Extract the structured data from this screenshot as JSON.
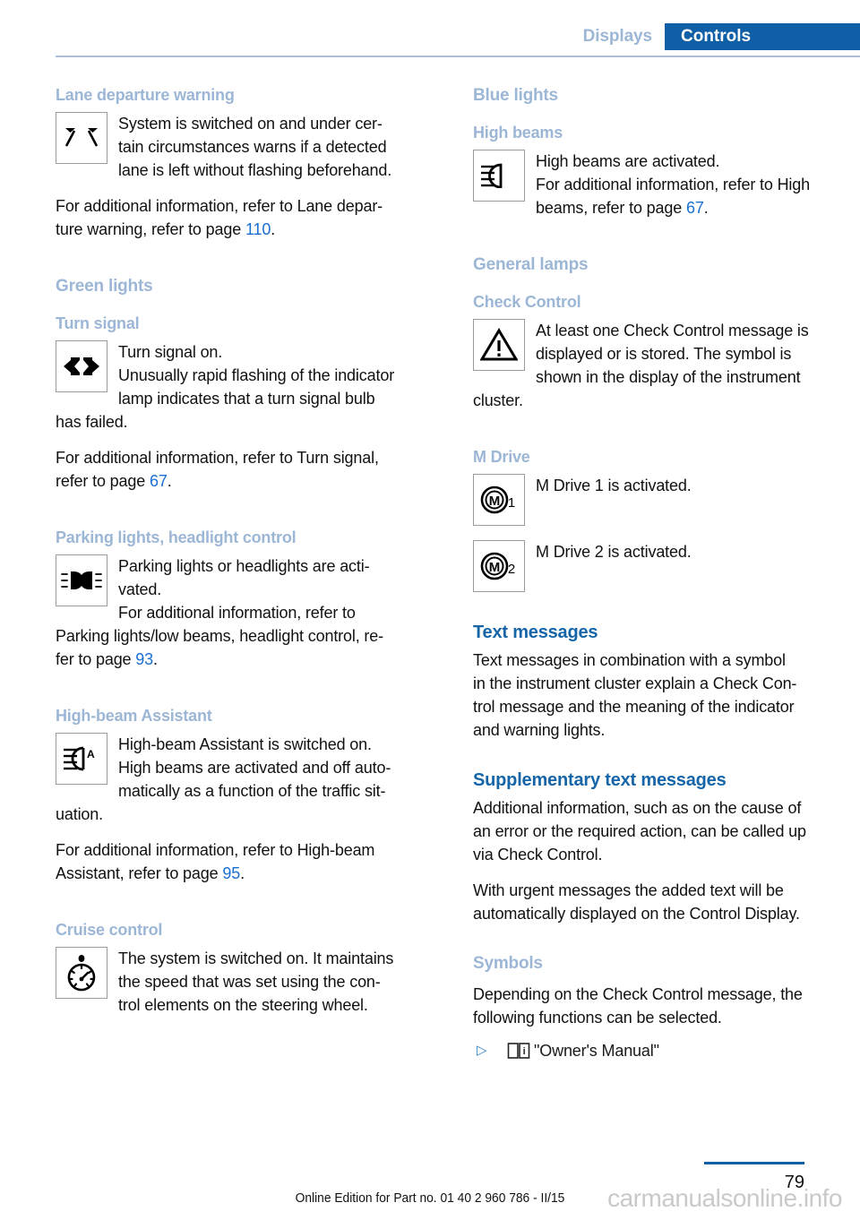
{
  "header": {
    "tab_inactive": "Displays",
    "tab_active": "Controls",
    "accent_blue": "#0f5fa6",
    "light_blue": "#9cb6d6"
  },
  "left_column": {
    "lane_departure": {
      "heading": "Lane departure warning",
      "icon_name": "lane-departure-warning-icon",
      "text_line1": "System is switched on and under cer-",
      "text_line2": "tain circumstances warns if a detected",
      "text_line3": "lane is left without flashing beforehand.",
      "para2_a": "For additional information, refer to Lane depar-",
      "para2_b": "ture warning, refer to page ",
      "page_ref": "110",
      "para2_end": "."
    },
    "green_lights": {
      "heading": "Green lights"
    },
    "turn_signal": {
      "heading": "Turn signal",
      "icon_name": "turn-signal-icon",
      "text_line1": "Turn signal on.",
      "text_line2": "Unusually rapid flashing of the indicator",
      "text_line3": "lamp indicates that a turn signal bulb",
      "text_line4": "has failed.",
      "para2_a": "For additional information, refer to Turn signal,",
      "para2_b": "refer to page ",
      "page_ref": "67",
      "para2_end": "."
    },
    "parking_lights": {
      "heading": "Parking lights, headlight control",
      "icon_name": "parking-lights-icon",
      "text_line1": "Parking lights or headlights are acti-",
      "text_line2": "vated.",
      "text_line3": "For additional information, refer to",
      "text_line4": "Parking lights/low beams, headlight control, re-",
      "text_line5": "fer to page ",
      "page_ref": "93",
      "text_end": "."
    },
    "high_beam_assistant": {
      "heading": "High-beam Assistant",
      "icon_name": "high-beam-assistant-icon",
      "text_line1": "High-beam Assistant is switched on.",
      "text_line2": "High beams are activated and off auto-",
      "text_line3": "matically as a function of the traffic sit-",
      "text_line4": "uation.",
      "para2_a": "For additional information, refer to High-beam",
      "para2_b": "Assistant, refer to page ",
      "page_ref": "95",
      "para2_end": "."
    },
    "cruise_control": {
      "heading": "Cruise control",
      "icon_name": "cruise-control-icon",
      "text_line1": "The system is switched on. It maintains",
      "text_line2": "the speed that was set using the con-",
      "text_line3": "trol elements on the steering wheel."
    }
  },
  "right_column": {
    "blue_lights": {
      "heading": "Blue lights"
    },
    "high_beams": {
      "heading": "High beams",
      "icon_name": "high-beams-icon",
      "text_line1": "High beams are activated.",
      "text_line2": "For additional information, refer to High",
      "text_line3": "beams, refer to page ",
      "page_ref": "67",
      "text_end": "."
    },
    "general_lamps": {
      "heading": "General lamps"
    },
    "check_control": {
      "heading": "Check Control",
      "icon_name": "warning-triangle-icon",
      "text_line1": "At least one Check Control message is",
      "text_line2": "displayed or is stored. The symbol is",
      "text_line3": "shown in the display of the instrument",
      "text_line4": "cluster."
    },
    "m_drive": {
      "heading": "M Drive",
      "item1_icon_name": "m-drive-1-icon",
      "item1_text": "M Drive 1 is activated.",
      "item2_icon_name": "m-drive-2-icon",
      "item2_text": "M Drive 2 is activated."
    },
    "text_messages": {
      "heading": "Text messages",
      "line1": "Text messages in combination with a symbol",
      "line2": "in the instrument cluster explain a Check Con-",
      "line3": "trol message and the meaning of the indicator",
      "line4": "and warning lights."
    },
    "supplementary": {
      "heading": "Supplementary text messages",
      "p1_line1": "Additional information, such as on the cause of",
      "p1_line2": "an error or the required action, can be called up",
      "p1_line3": "via Check Control.",
      "p2_line1": "With urgent messages the added text will be",
      "p2_line2": "automatically displayed on the Control Display."
    },
    "symbols": {
      "heading": "Symbols",
      "p1_line1": "Depending on the Check Control message, the",
      "p1_line2": "following functions can be selected.",
      "bullets": [
        {
          "marker": "▷",
          "icon_name": "owners-manual-book-icon",
          "label": "\"Owner's Manual\""
        }
      ]
    }
  },
  "footer": {
    "edition": "Online Edition for Part no. 01 40 2 960 786 - II/15",
    "page_number": "79",
    "watermark": "carmanualsonline.info"
  }
}
